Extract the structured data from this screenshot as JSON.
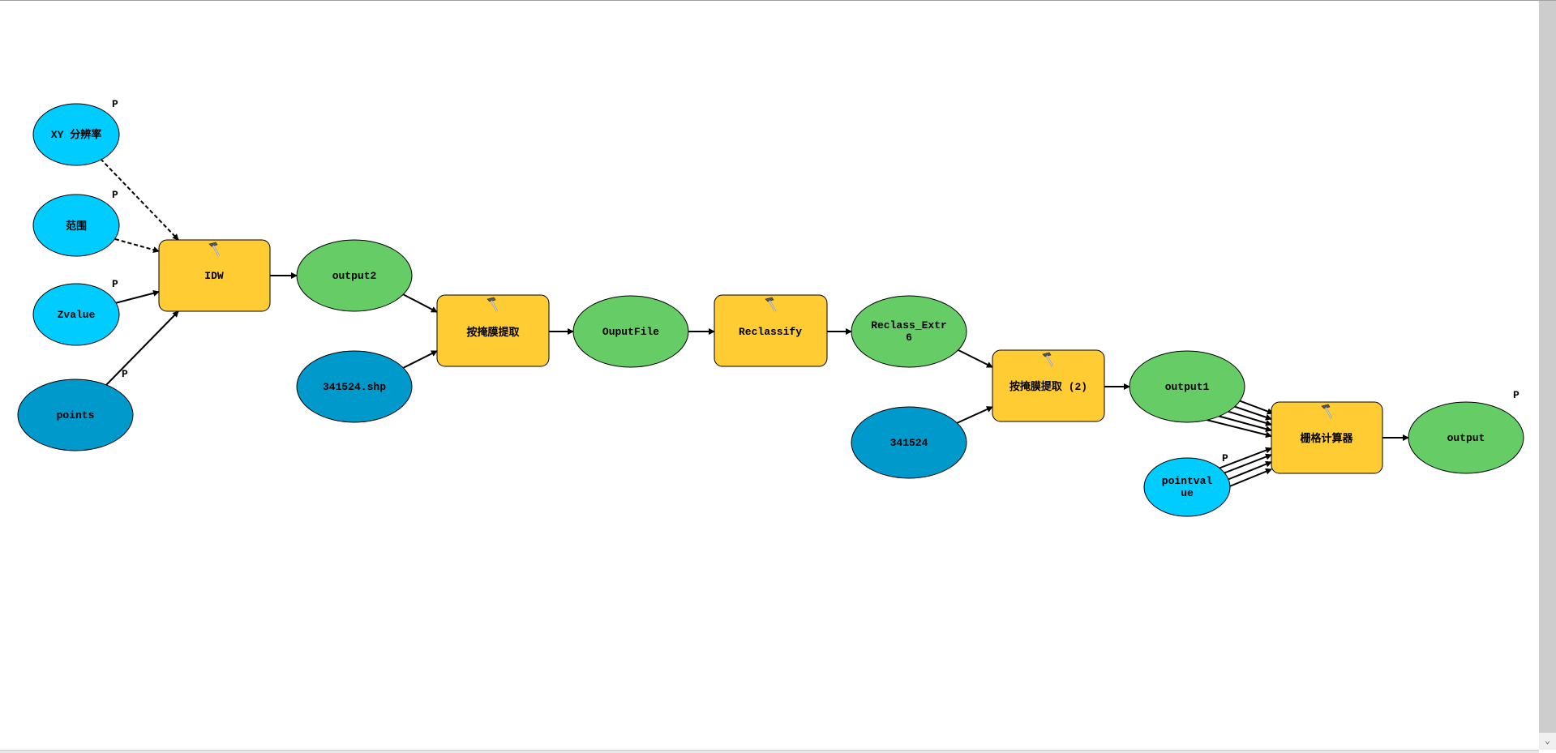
{
  "colors": {
    "input_param": "#00CCFF",
    "input_data": "#0099CC",
    "derived_data": "#66CC66",
    "tool": "#FFCC33"
  },
  "parameter_marker": "P",
  "nodes": {
    "xy_resolution": "XY 分辨率",
    "extent": "范围",
    "zvalue": "Zvalue",
    "points": "points",
    "idw": "IDW",
    "output2": "output2",
    "shp": "341524.shp",
    "extract_mask": "按掩膜提取",
    "ouputfile": "OuputFile",
    "reclassify": "Reclassify",
    "reclass_line1": "Reclass_Extr",
    "reclass_line2": "6",
    "extract_mask2": "按掩膜提取 (2)",
    "raster341524": "341524",
    "output1": "output1",
    "pointvalue_line1": "pointval",
    "pointvalue_line2": "ue",
    "raster_calc": "栅格计算器",
    "output": "output"
  },
  "icons": {
    "tool": "hammer-icon",
    "scroll_down": "chevron-down-icon"
  }
}
